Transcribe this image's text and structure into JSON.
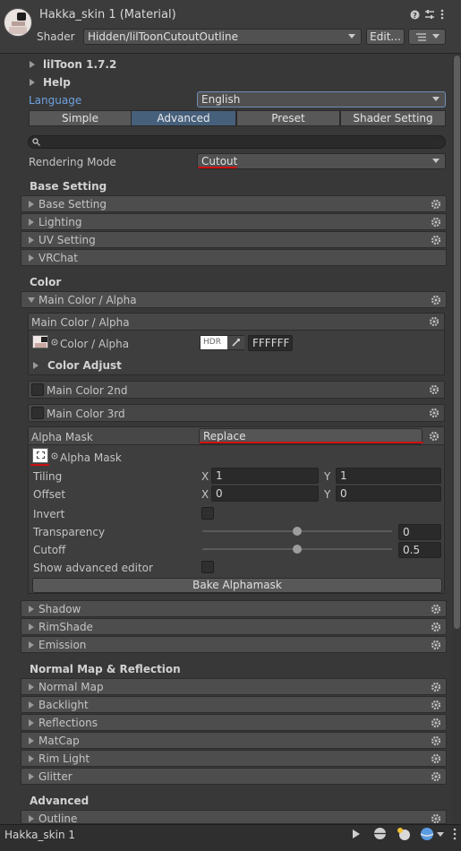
{
  "header": {
    "title": "Hakka_skin 1 (Material)",
    "shader_label": "Shader",
    "shader_value": "Hidden/lilToonCutoutOutline",
    "edit_label": "Edit..."
  },
  "sections_top": {
    "liltoon": "lilToon 1.7.2",
    "help": "Help",
    "language_label": "Language",
    "language_value": "English"
  },
  "tabs": [
    "Simple",
    "Advanced",
    "Preset",
    "Shader Setting"
  ],
  "rendering_mode": {
    "label": "Rendering Mode",
    "value": "Cutout"
  },
  "base_setting": {
    "heading": "Base Setting",
    "items": [
      "Base Setting",
      "Lighting",
      "UV Setting",
      "VRChat"
    ]
  },
  "color": {
    "heading": "Color",
    "main_color_alpha": "Main Color / Alpha",
    "inner_title": "Main Color / Alpha",
    "color_alpha_label": "Color / Alpha",
    "hdr": "HDR",
    "hex": "FFFFFF",
    "color_adjust": "Color Adjust",
    "main_color_2nd": "Main Color 2nd",
    "main_color_3rd": "Main Color 3rd"
  },
  "alpha_mask": {
    "label": "Alpha Mask",
    "mode": "Replace",
    "texture_label": "Alpha Mask",
    "tiling_label": "Tiling",
    "tiling_x": "1",
    "tiling_y": "1",
    "offset_label": "Offset",
    "offset_x": "0",
    "offset_y": "0",
    "x": "X",
    "y": "Y",
    "invert": "Invert",
    "transparency_label": "Transparency",
    "transparency_value": "0",
    "transparency_fraction": 0.5,
    "cutoff_label": "Cutoff",
    "cutoff_value": "0.5",
    "cutoff_fraction": 0.5,
    "show_advanced": "Show advanced editor",
    "bake": "Bake Alphamask"
  },
  "more_color_items": [
    "Shadow",
    "RimShade",
    "Emission"
  ],
  "normal_map": {
    "heading": "Normal Map & Reflection",
    "items": [
      "Normal Map",
      "Backlight",
      "Reflections",
      "MatCap",
      "Rim Light",
      "Glitter"
    ]
  },
  "advanced": {
    "heading": "Advanced",
    "items": [
      "Outline"
    ]
  },
  "bottom_bar": {
    "title": "Hakka_skin 1"
  }
}
